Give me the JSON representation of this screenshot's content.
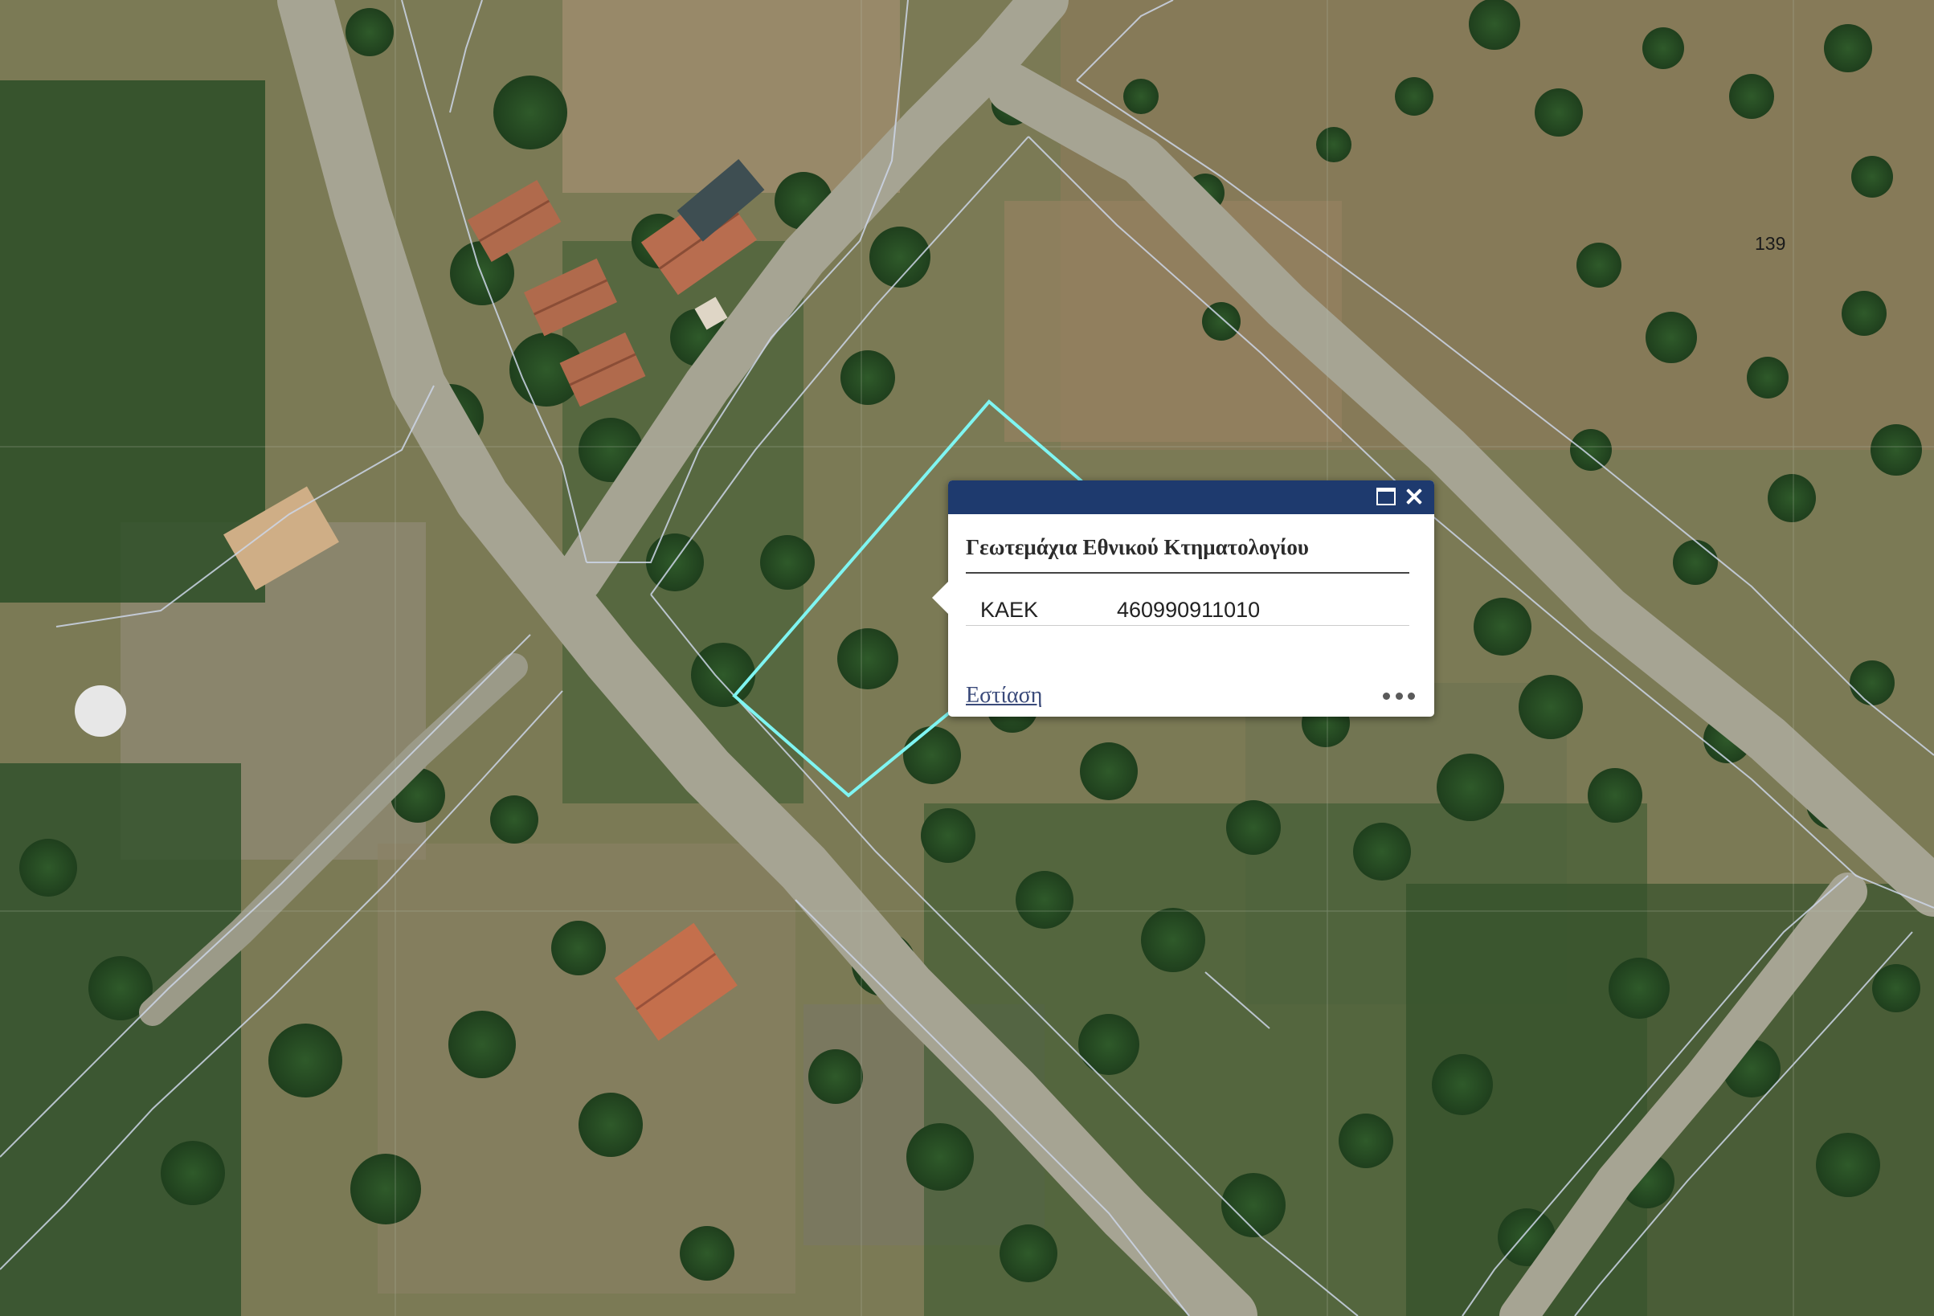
{
  "map": {
    "parcel_number_label": "139"
  },
  "popup": {
    "title": "Γεωτεμάχια Εθνικού Κτηματολογίου",
    "attributes": [
      {
        "key": "ΚΑΕΚ",
        "value": "460990911010"
      }
    ],
    "zoom_link": "Εστίαση",
    "maximize_icon": "maximize-icon",
    "close_icon": "close-icon",
    "more_icon": "ellipsis-icon"
  },
  "colors": {
    "header": "#1e3a6e",
    "selected_parcel_outline": "#7ff5f2",
    "parcel_lines": "#c9d3e4"
  }
}
